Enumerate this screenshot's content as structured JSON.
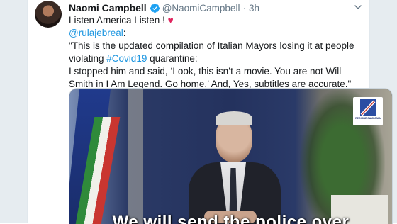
{
  "tweet": {
    "author": {
      "display_name": "Naomi Campbell",
      "handle": "@NaomiCampbell",
      "separator": "·",
      "time": "3h"
    },
    "lines": {
      "line1": "Listen America Listen  ! ",
      "heart": "♥",
      "mention": "@rulajebreal",
      "colon": ":",
      "line3": "\"This is the updated compilation of Italian Mayors losing it at people violating ",
      "hashtag": "#Covid19",
      "line3_tail": " quarantine:",
      "line4": "I stopped him and said, ‘Look, this isn’t a movie. You are not Will Smith in I Am Legend. Go home.’ And, Yes, subtitles are accurate.\""
    },
    "video": {
      "logo_caption": "REGIONE CAMPANIA",
      "subtitle": "We will send the police over"
    }
  },
  "colors": {
    "link": "#1b95e0",
    "verified": "#1da1f2",
    "heart": "#e0245e"
  },
  "icons": [
    "verified-badge-icon",
    "chevron-down-icon",
    "heart-icon"
  ]
}
